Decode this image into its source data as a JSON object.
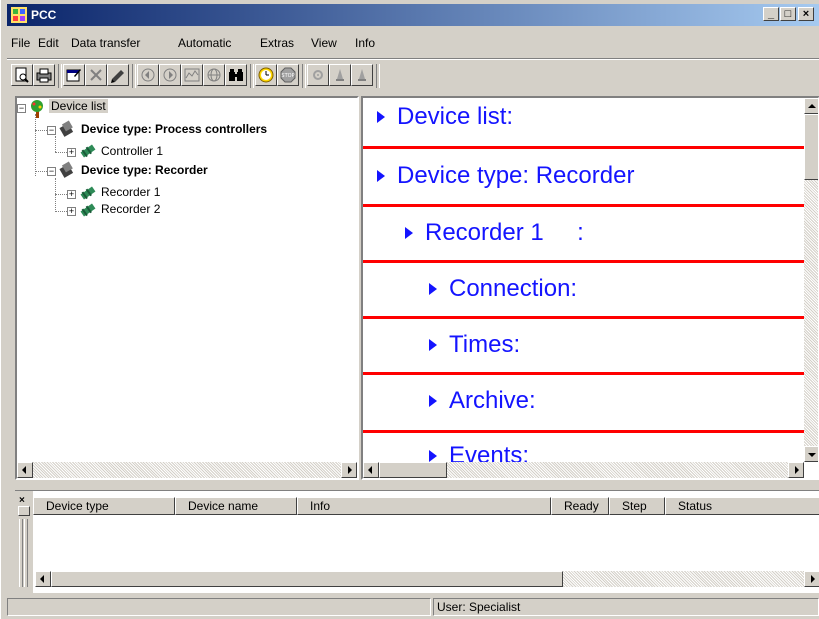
{
  "window": {
    "title": "PCC"
  },
  "menu": [
    "File",
    "Edit",
    "Data transfer",
    "Automatic",
    "Extras",
    "View",
    "Info"
  ],
  "toolbar": {
    "buttons": [
      "print-preview-icon",
      "print-icon",
      "properties-icon",
      "delete-icon",
      "edit-icon",
      "upload-icon",
      "download-icon",
      "chart-icon",
      "globe-icon",
      "find-icon",
      "clock-icon",
      "stop-icon",
      "settings-icon",
      "alarm-icon",
      "alarm-off-icon"
    ]
  },
  "tree": {
    "root": "Device list",
    "types": [
      {
        "label": "Device type: Process controllers",
        "children": [
          "Controller 1"
        ]
      },
      {
        "label": "Device type: Recorder",
        "children": [
          "Recorder 1",
          "Recorder 2"
        ]
      }
    ]
  },
  "document": {
    "rows": [
      "Device list:",
      "Device type: Recorder",
      "Recorder 1     :",
      "Connection:",
      "Times:",
      "Archive:",
      "Events:"
    ]
  },
  "table": {
    "columns": [
      "Device type",
      "Device name",
      "Info",
      "Ready",
      "Step",
      "Status"
    ]
  },
  "status": {
    "user": "User: Specialist"
  },
  "colors": {
    "titlebar_start": "#0a246a",
    "link": "#1414ff",
    "divider": "#ff0000",
    "chrome": "#d4d0c8"
  }
}
